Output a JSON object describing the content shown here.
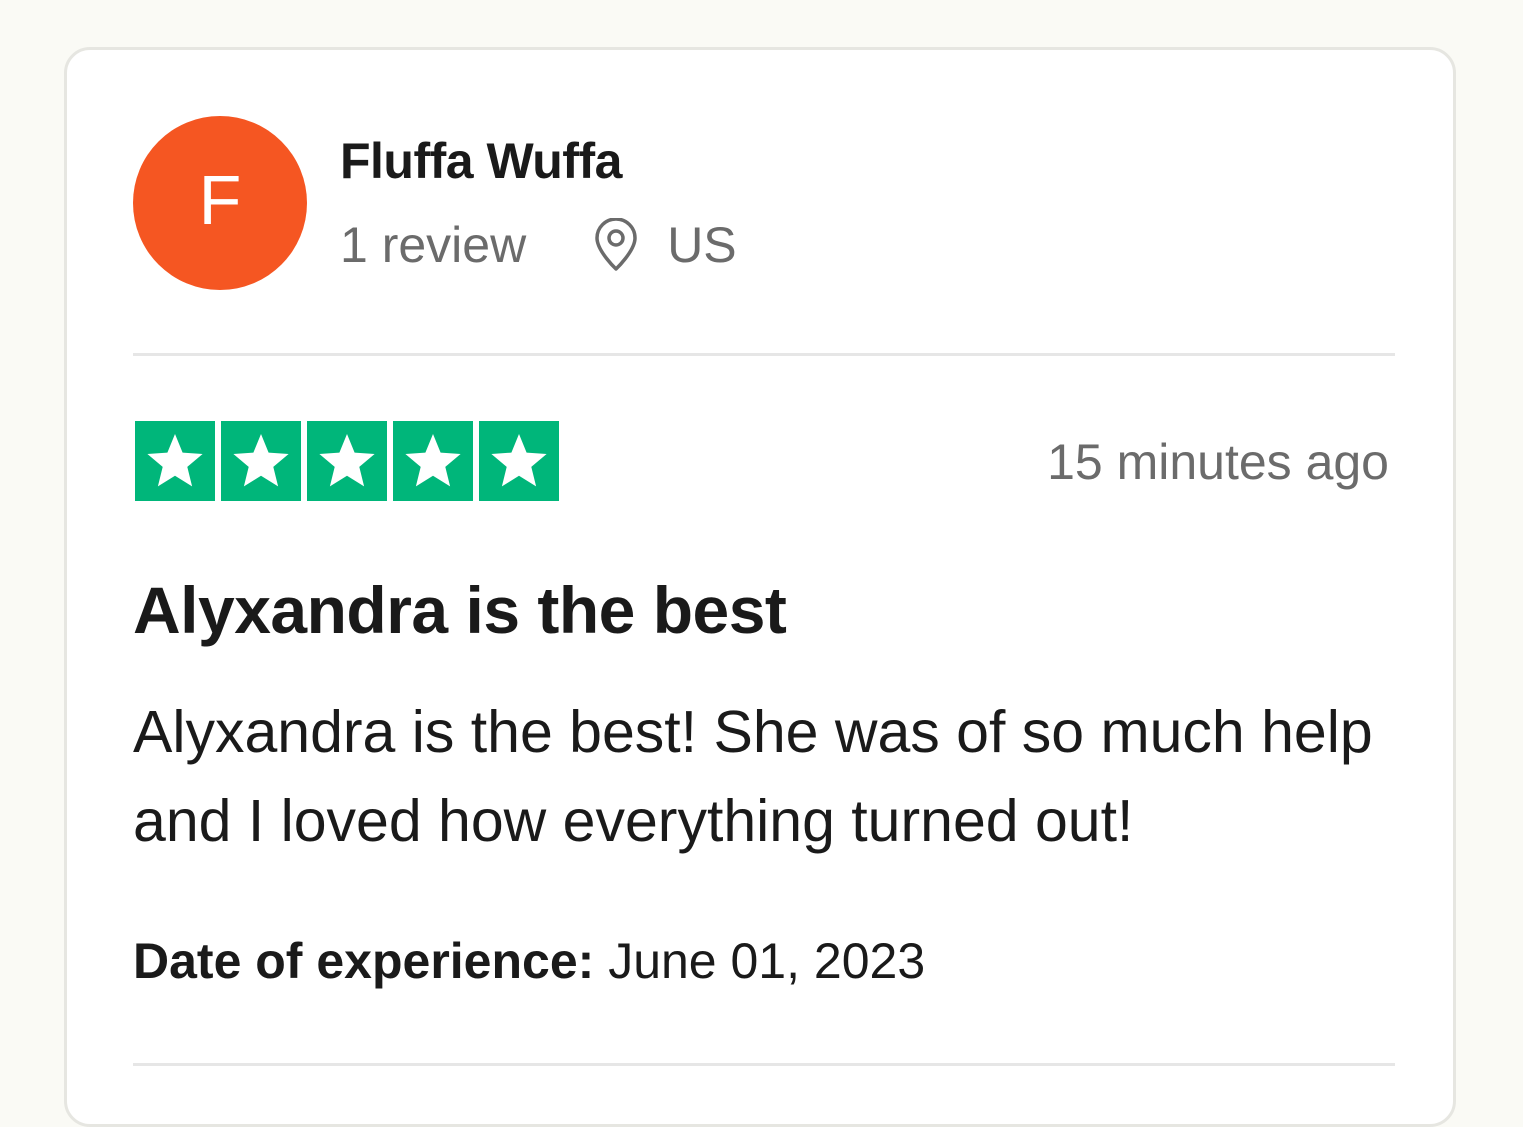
{
  "colors": {
    "avatar_bg": "#f55622",
    "star_fill": "#00b67a",
    "page_bg": "#fafaf5"
  },
  "reviewer": {
    "initial": "F",
    "name": "Fluffa Wuffa",
    "review_count": "1 review",
    "location_icon": "location-pin-icon",
    "country": "US"
  },
  "review": {
    "rating": 5,
    "rating_max": 5,
    "star_icon": "star-icon",
    "time_ago": "15 minutes ago",
    "title": "Alyxandra is the best",
    "body": "Alyxandra is the best! She was of so much help and I loved how everything turned out!",
    "experience_label": "Date of experience:",
    "experience_date": "June 01, 2023"
  }
}
